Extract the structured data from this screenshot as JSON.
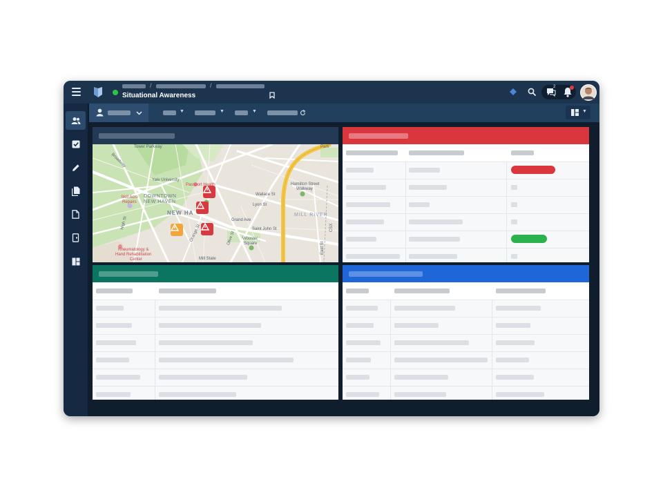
{
  "app": {
    "title": "Situational Awareness",
    "status_color": "#2ec24a"
  },
  "icons": {
    "menu": "hamburger-menu-icon",
    "bookmark": "bookmark-icon",
    "search": "search-icon",
    "chat": "chat-icon",
    "notifications": "bell-icon",
    "layout": "layout-grid-icon",
    "refresh": "refresh-icon"
  },
  "topbar": {
    "chat_badge": "2"
  },
  "sidebar": {
    "items": [
      {
        "icon": "users-icon",
        "active": true
      },
      {
        "icon": "checkbox-icon",
        "active": false
      },
      {
        "icon": "pencil-icon",
        "active": false
      },
      {
        "icon": "documents-icon",
        "active": false
      },
      {
        "icon": "file-icon",
        "active": false
      },
      {
        "icon": "exit-icon",
        "active": false
      },
      {
        "icon": "dashboard-icon",
        "active": false
      }
    ]
  },
  "colors": {
    "panel_map": "#233a56",
    "panel_alerts": "#d9363e",
    "panel_green": "#0c7561",
    "panel_blue": "#1f66d9",
    "pill_red": "#d9363e",
    "pill_green": "#2bb24c",
    "marker_red": "#d63a3f",
    "marker_orange": "#f0a63a"
  },
  "map": {
    "labels": {
      "tower_parkway": "Tower Parkway",
      "yale_university": "Yale University",
      "passport_health": "Passport Health",
      "downtown": "DOWNTOWN",
      "new_haven_top": "NEW HAVEN",
      "new_haven_big": "NEW HA",
      "skill_acro": "Skill Acro",
      "repairs": "Repairs",
      "grand_ave": "Grand Ave",
      "hamilton": "Hamilton Street",
      "walkway": "Walkway",
      "mill_river": "MILL RIVER",
      "wooster": "Wooster",
      "square": "Square",
      "rheumatology": "Rheumatology &",
      "rehab": "Hand Rehabilitation",
      "center": "Center",
      "lyon": "Lyon St",
      "wallace": "Wallace St",
      "olive": "Olive St",
      "orange": "Orange St",
      "john": "Saint John St",
      "east": "East St",
      "park": "Park",
      "csx": "CSX",
      "high": "High St",
      "broadway": "Broadway",
      "mill_state": "Mill State"
    }
  }
}
